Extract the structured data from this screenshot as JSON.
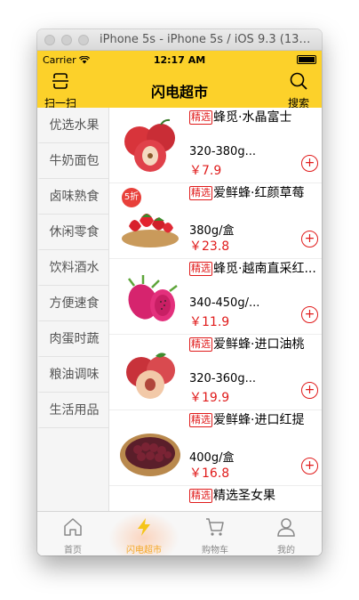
{
  "window": {
    "title": "iPhone 5s - iPhone 5s / iOS 9.3 (13E..."
  },
  "status_bar": {
    "carrier": "Carrier",
    "time": "12:17 AM"
  },
  "nav": {
    "scan_label": "扫一扫",
    "title": "闪电超市",
    "search_label": "搜索"
  },
  "sidebar": {
    "items": [
      {
        "label": "优选水果"
      },
      {
        "label": "牛奶面包"
      },
      {
        "label": "卤味熟食"
      },
      {
        "label": "休闲零食"
      },
      {
        "label": "饮料酒水"
      },
      {
        "label": "方便速食"
      },
      {
        "label": "肉蛋时蔬"
      },
      {
        "label": "粮油调味"
      },
      {
        "label": "生活用品"
      }
    ]
  },
  "products": [
    {
      "tag": "精选",
      "name": "蜂觅·水晶富士",
      "spec": "320-380g...",
      "price": "￥7.9",
      "add": "+"
    },
    {
      "tag": "精选",
      "name": "爱鲜蜂·红颜草莓",
      "spec": "380g/盒",
      "price": "￥23.8",
      "add": "+",
      "badge": "5折"
    },
    {
      "tag": "精选",
      "name": "蜂觅·越南直采红...",
      "spec": "340-450g/...",
      "price": "￥11.9",
      "add": "+"
    },
    {
      "tag": "精选",
      "name": "爱鲜蜂·进口油桃",
      "spec": "320-360g...",
      "price": "￥19.9",
      "add": "+"
    },
    {
      "tag": "精选",
      "name": "爱鲜蜂·进口红提",
      "spec": "400g/盒",
      "price": "￥16.8",
      "add": "+"
    },
    {
      "tag": "精选",
      "name": "精选圣女果",
      "spec": "",
      "price": "",
      "add": ""
    }
  ],
  "tabbar": {
    "items": [
      {
        "label": "首页",
        "icon": "home-icon"
      },
      {
        "label": "闪电超市",
        "icon": "lightning-icon"
      },
      {
        "label": "购物车",
        "icon": "cart-icon"
      },
      {
        "label": "我的",
        "icon": "user-icon"
      }
    ]
  },
  "colors": {
    "accent": "#fcd12a",
    "price": "#e01b1b",
    "active_tab": "#f5a623"
  }
}
